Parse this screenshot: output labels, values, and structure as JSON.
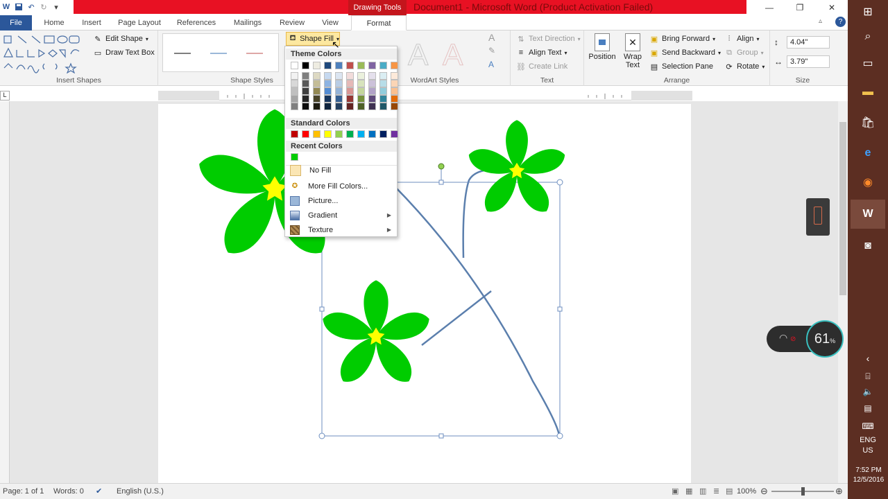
{
  "app": {
    "context_label": "Drawing Tools",
    "title": "Document1 - Microsoft Word (Product Activation Failed)"
  },
  "tabs": [
    "File",
    "Home",
    "Insert",
    "Page Layout",
    "References",
    "Mailings",
    "Review",
    "View",
    "Format"
  ],
  "ribbon": {
    "insert_shapes": {
      "label": "Insert Shapes",
      "edit_shape": "Edit Shape",
      "draw_text_box": "Draw Text Box"
    },
    "shape_styles": {
      "label": "Shape Styles",
      "shape_fill": "Shape Fill"
    },
    "wordart": {
      "label": "WordArt Styles"
    },
    "text": {
      "label": "Text",
      "text_direction": "Text Direction",
      "align_text": "Align Text",
      "create_link": "Create Link"
    },
    "arrange": {
      "label": "Arrange",
      "position": "Position",
      "wrap_text": "Wrap Text",
      "bring_forward": "Bring Forward",
      "send_backward": "Send Backward",
      "selection_pane": "Selection Pane",
      "align": "Align",
      "group": "Group",
      "rotate": "Rotate"
    },
    "size": {
      "label": "Size",
      "height": "4.04\"",
      "width": "3.79\""
    }
  },
  "dropdown": {
    "theme_colors_title": "Theme Colors",
    "standard_colors_title": "Standard Colors",
    "recent_colors_title": "Recent Colors",
    "theme_top": [
      "#ffffff",
      "#000000",
      "#eeece1",
      "#1f497d",
      "#4f81bd",
      "#c0504d",
      "#9bbb59",
      "#8064a2",
      "#4bacc6",
      "#f79646"
    ],
    "theme_shades": [
      [
        "#f2f2f2",
        "#7f7f7f",
        "#ddd9c3",
        "#c6d9f0",
        "#dbe5f1",
        "#f2dcdb",
        "#ebf1dd",
        "#e5e0ec",
        "#dbeef3",
        "#fdeada"
      ],
      [
        "#d8d8d8",
        "#595959",
        "#c4bd97",
        "#8db3e2",
        "#b8cce4",
        "#e5b9b7",
        "#d7e3bc",
        "#ccc1d9",
        "#b7dde8",
        "#fbd5b5"
      ],
      [
        "#bfbfbf",
        "#3f3f3f",
        "#938953",
        "#548dd4",
        "#95b3d7",
        "#d99694",
        "#c3d69b",
        "#b2a2c7",
        "#92cddc",
        "#fac08f"
      ],
      [
        "#a5a5a5",
        "#262626",
        "#494429",
        "#17365d",
        "#366092",
        "#953734",
        "#76923c",
        "#5f497a",
        "#31859b",
        "#e36c09"
      ],
      [
        "#7f7f7f",
        "#0c0c0c",
        "#1d1b10",
        "#0f243e",
        "#244061",
        "#632423",
        "#4f6128",
        "#3f3151",
        "#205867",
        "#974806"
      ]
    ],
    "standard": [
      "#c00000",
      "#ff0000",
      "#ffc000",
      "#ffff00",
      "#92d050",
      "#00b050",
      "#00b0f0",
      "#0070c0",
      "#002060",
      "#7030a0"
    ],
    "recent": [
      "#00cc00"
    ],
    "items": [
      {
        "label": "No Fill",
        "icon": "no-fill-icon"
      },
      {
        "label": "More Fill Colors...",
        "icon": "palette-icon"
      },
      {
        "label": "Picture...",
        "icon": "picture-icon"
      },
      {
        "label": "Gradient",
        "icon": "gradient-icon",
        "submenu": true
      },
      {
        "label": "Texture",
        "icon": "texture-icon",
        "submenu": true
      }
    ]
  },
  "status": {
    "page": "Page: 1 of 1",
    "words": "Words: 0",
    "language": "English (U.S.)",
    "zoom": "100%"
  },
  "system": {
    "battery": "61",
    "lang_top": "ENG",
    "lang_bottom": "US",
    "time": "7:52 PM",
    "date": "12/5/2016"
  },
  "colors": {
    "accent": "#2b579a",
    "flower_petal": "#00cc00",
    "flower_center": "#ffff00",
    "stem": "#5b7fad",
    "context": "#e81123"
  }
}
